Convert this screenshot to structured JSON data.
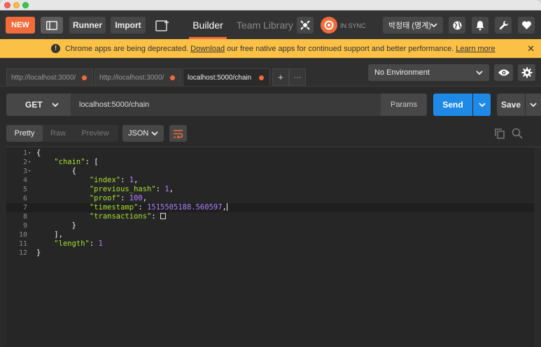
{
  "toolbar": {
    "new_label": "NEW",
    "runner_label": "Runner",
    "import_label": "Import",
    "builder_label": "Builder",
    "team_library_label": "Team Library",
    "sync_status": "IN SYNC",
    "user_name": "박정태 (명계)"
  },
  "banner": {
    "text_before": "Chrome apps are being deprecated. ",
    "download_link": "Download",
    "text_after": " our free native apps for continued support and better performance.",
    "learn_more_link": "Learn more",
    "close_glyph": "✕"
  },
  "request_tabs": [
    {
      "label": "http://localhost:3000/",
      "active": false
    },
    {
      "label": "http://localhost:3000/",
      "active": false
    },
    {
      "label": "localhost:5000/chain",
      "active": true
    }
  ],
  "tab_add_glyph": "+",
  "tab_more_glyph": "···",
  "environment": {
    "selected": "No Environment"
  },
  "request": {
    "method": "GET",
    "url": "localhost:5000/chain",
    "params_label": "Params",
    "send_label": "Send",
    "save_label": "Save"
  },
  "response": {
    "view_tabs": [
      "Pretty",
      "Raw",
      "Preview"
    ],
    "active_view": "Pretty",
    "format": "JSON",
    "line_numbers": [
      "1",
      "2",
      "3",
      "4",
      "5",
      "6",
      "7",
      "8",
      "9",
      "10",
      "11",
      "12"
    ],
    "code": {
      "l1_open": "{",
      "chain_key": "\"chain\"",
      "l2_rest": ": [",
      "l3_open": "{",
      "index_key": "\"index\"",
      "index_val": "1",
      "prev_key": "\"previous_hash\"",
      "prev_val": "1",
      "proof_key": "\"proof\"",
      "proof_val": "100",
      "ts_key": "\"timestamp\"",
      "ts_val": "1515505188.560597",
      "tx_key": "\"transactions\"",
      "l9_close": "}",
      "l10_close": "],",
      "length_key": "\"length\"",
      "length_val": "1",
      "l12_close": "}"
    }
  },
  "colors": {
    "accent_orange": "#f26b3a",
    "send_blue": "#1f8ae6",
    "banner_yellow": "#fbc046",
    "json_key_green": "#a6e22e",
    "json_number_purple": "#ae81ff"
  },
  "icons": [
    "layout-icon",
    "new-window-icon",
    "interceptor-icon",
    "sync-icon",
    "globe-icon",
    "bell-icon",
    "wrench-icon",
    "heart-icon",
    "warning-icon",
    "eye-icon",
    "gear-icon",
    "wrap-icon",
    "copy-icon",
    "search-icon"
  ]
}
